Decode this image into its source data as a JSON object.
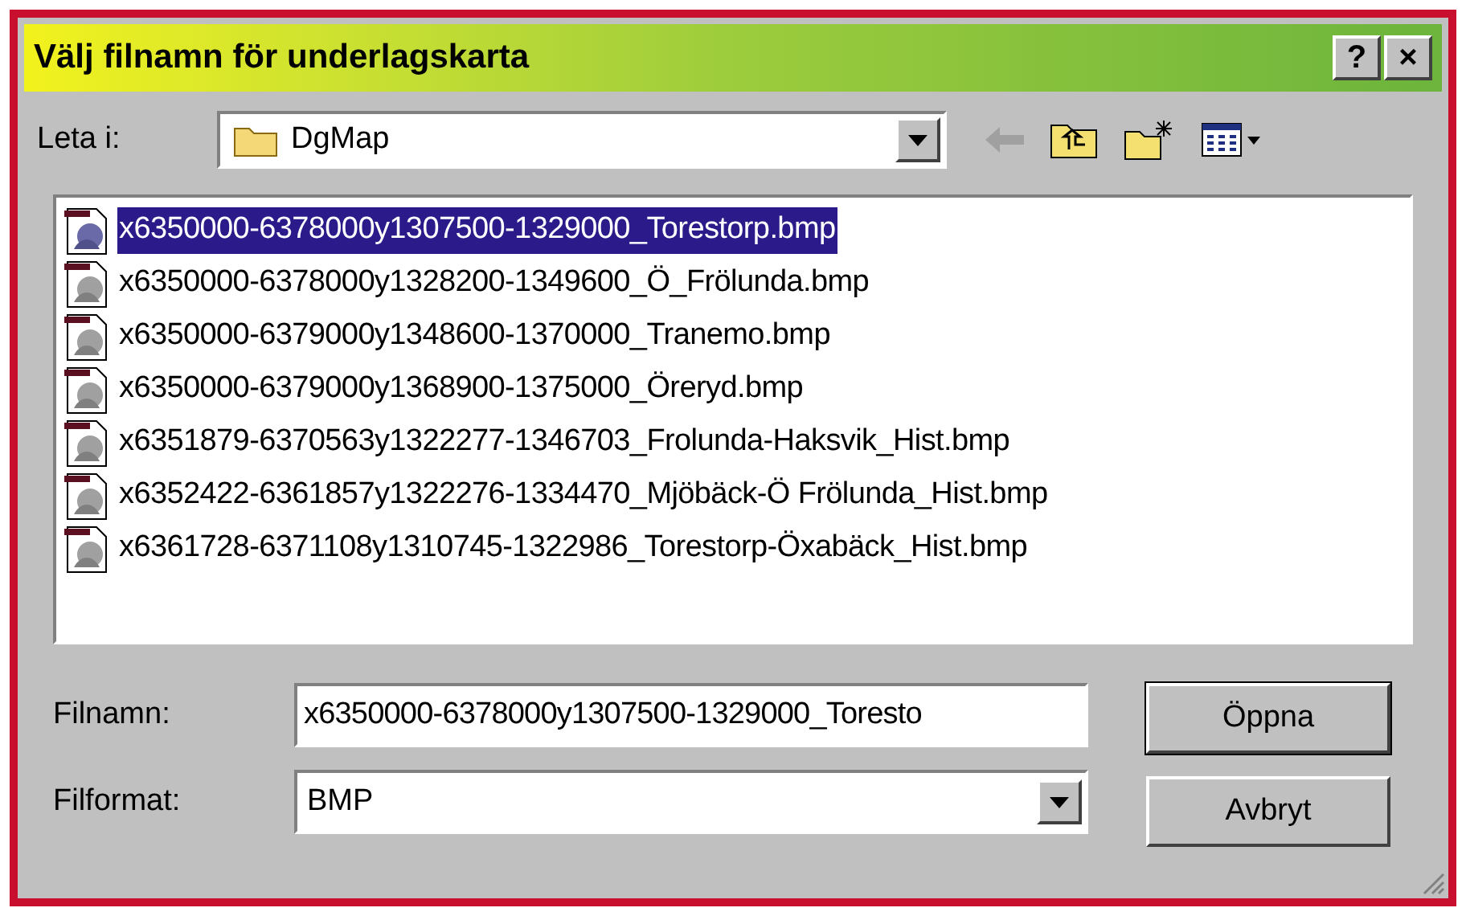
{
  "window": {
    "title": "Välj filnamn för underlagskarta",
    "buttons": [
      "?",
      "×"
    ]
  },
  "look_in": {
    "label": "Leta i:",
    "value": "DgMap"
  },
  "files": [
    {
      "name": "x6350000-6378000y1307500-1329000_Torestorp.bmp",
      "selected": true
    },
    {
      "name": "x6350000-6378000y1328200-1349600_Ö_Frölunda.bmp",
      "selected": false
    },
    {
      "name": "x6350000-6379000y1348600-1370000_Tranemo.bmp",
      "selected": false
    },
    {
      "name": "x6350000-6379000y1368900-1375000_Öreryd.bmp",
      "selected": false
    },
    {
      "name": "x6351879-6370563y1322277-1346703_Frolunda-Haksvik_Hist.bmp",
      "selected": false
    },
    {
      "name": "x6352422-6361857y1322276-1334470_Mjöbäck-Ö Frölunda_Hist.bmp",
      "selected": false
    },
    {
      "name": "x6361728-6371108y1310745-1322986_Torestorp-Öxabäck_Hist.bmp",
      "selected": false
    }
  ],
  "filename": {
    "label": "Filnamn:",
    "value": "x6350000-6378000y1307500-1329000_Toresto"
  },
  "format": {
    "label": "Filformat:",
    "value": "BMP"
  },
  "actions": [
    "Öppna",
    "Avbryt"
  ]
}
